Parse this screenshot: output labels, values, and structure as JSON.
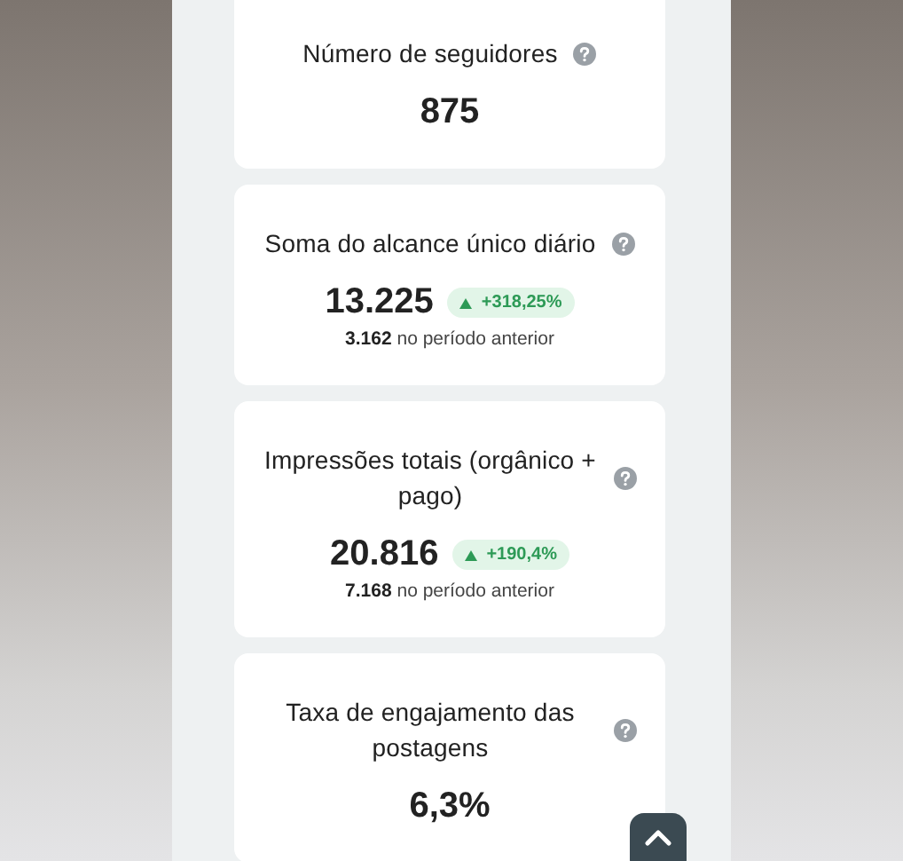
{
  "cards": [
    {
      "title": "Número de seguidores",
      "value": "875"
    },
    {
      "title": "Soma do alcance único diário",
      "value": "13.225",
      "change": {
        "up": true,
        "text": "+318,25%"
      },
      "previous": "**3.162** no período anterior"
    },
    {
      "title": "Impressões totais (orgânico + pago)",
      "value": "20.816",
      "change": {
        "up": true,
        "text": "+190,4%"
      },
      "previous": "**7.168** no período anterior"
    },
    {
      "title": "Taxa de engajamento das postagens",
      "value": "6,3%"
    }
  ]
}
